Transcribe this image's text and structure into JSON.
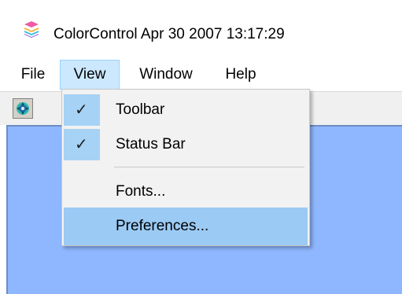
{
  "window": {
    "title": "ColorControl  Apr 30 2007 13:17:29",
    "icon": "app-color-stack-icon"
  },
  "menubar": {
    "items": [
      {
        "label": "File"
      },
      {
        "label": "View"
      },
      {
        "label": "Window"
      },
      {
        "label": "Help"
      }
    ]
  },
  "toolbar": {
    "buttons": [
      {
        "icon": "color-wheel-icon"
      }
    ]
  },
  "view_menu": {
    "items": [
      {
        "label": "Toolbar",
        "checked": true
      },
      {
        "label": "Status Bar",
        "checked": true
      },
      {
        "label": "Fonts..."
      },
      {
        "label": "Preferences...",
        "highlighted": true
      }
    ],
    "check_glyph": "✓"
  },
  "colors": {
    "client_background": "#8fb7ff",
    "menu_highlight": "#9bcaf5",
    "check_highlight": "#a6d2f6",
    "active_menu": "#cce8ff"
  }
}
